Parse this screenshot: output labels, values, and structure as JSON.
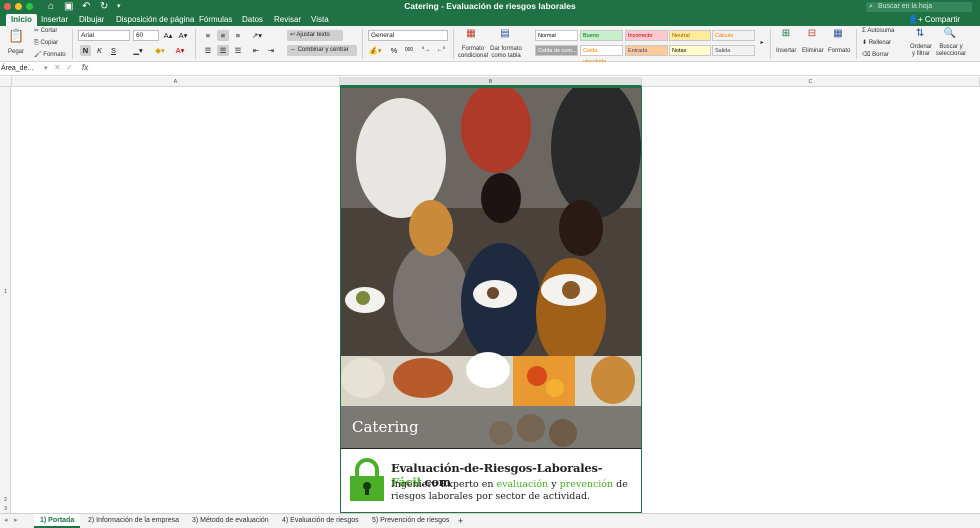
{
  "titlebar": {
    "title": "Catering - Evaluación de riesgos laborales",
    "search_placeholder": "Buscar en la hoja",
    "qa_icons": {
      "home": "⌂",
      "save": "▣",
      "undo": "↶",
      "redo": "↻",
      "more": "▾"
    }
  },
  "tabs": [
    {
      "label": "Inicio",
      "active": true
    },
    {
      "label": "Insertar"
    },
    {
      "label": "Dibujar"
    },
    {
      "label": "Disposición de página"
    },
    {
      "label": "Fórmulas"
    },
    {
      "label": "Datos"
    },
    {
      "label": "Revisar"
    },
    {
      "label": "Vista"
    }
  ],
  "share_label": "Compartir",
  "ribbon": {
    "paste": "Pegar",
    "cut": "Cortar",
    "copy": "Copiar",
    "format_painter": "Formato",
    "font_name": "Arial",
    "font_size": "60",
    "bold": "N",
    "italic": "K",
    "underline": "S",
    "wrap_text": "Ajustar texto",
    "merge_center": "Combinar y centrar",
    "number_format": "General",
    "percent": "%",
    "thousands": "000",
    "conditional_format": "Formato condicional",
    "format_table": "Dar formato como tabla",
    "styles": [
      {
        "label": "Normal",
        "bg": "#ffffff",
        "color": "#000000"
      },
      {
        "label": "Bueno",
        "bg": "#c6efce",
        "color": "#006100"
      },
      {
        "label": "Incorrecto",
        "bg": "#ffc7ce",
        "color": "#9c0006"
      },
      {
        "label": "Neutral",
        "bg": "#ffeb9c",
        "color": "#9c5700"
      },
      {
        "label": "Cálculo",
        "bg": "#f2f2f2",
        "color": "#fa7d00"
      },
      {
        "label": "Celda de com...",
        "bg": "#a5a5a5",
        "color": "#ffffff"
      },
      {
        "label": "Celda vinculada",
        "bg": "#ffffff",
        "color": "#fa7d00"
      },
      {
        "label": "Entrada",
        "bg": "#ffcc99",
        "color": "#3f3f76"
      },
      {
        "label": "Notas",
        "bg": "#ffffcc",
        "color": "#000000"
      },
      {
        "label": "Salida",
        "bg": "#f2f2f2",
        "color": "#3f3f3f"
      }
    ],
    "insert": "Insertar",
    "delete": "Eliminar",
    "format": "Formato",
    "autosum": "Autosuma",
    "fill": "Rellenar",
    "clear": "Borrar",
    "sort_filter": "Ordenar y filtrar",
    "find_select": "Buscar y seleccionar"
  },
  "formula_bar": {
    "name_box": "Área_de...",
    "fx": "fx",
    "content": ""
  },
  "columns": [
    "A",
    "B",
    "C"
  ],
  "rows": [
    "1",
    "2",
    "3"
  ],
  "cover": {
    "banner_title": "Catering",
    "brand_prefix": "Evaluación-de-Riesgos-Laborales-",
    "brand_highlight": "Fácil",
    "brand_suffix": ".com",
    "tagline_1": "Ingeniero Experto en ",
    "tagline_kw1": "evaluación",
    "tagline_2": " y ",
    "tagline_kw2": "prevención",
    "tagline_3": " de riesgos laborales por sector de actividad."
  },
  "sheets": [
    {
      "label": "1) Portada",
      "active": true
    },
    {
      "label": "2) Información de la empresa"
    },
    {
      "label": "3) Método de evaluación"
    },
    {
      "label": "4) Evaluación de riesgos"
    },
    {
      "label": "5) Prevención de riesgos"
    }
  ],
  "add_sheet": "+",
  "colors": {
    "excel_green": "#1f7244",
    "brand_green": "#4caf2a"
  }
}
